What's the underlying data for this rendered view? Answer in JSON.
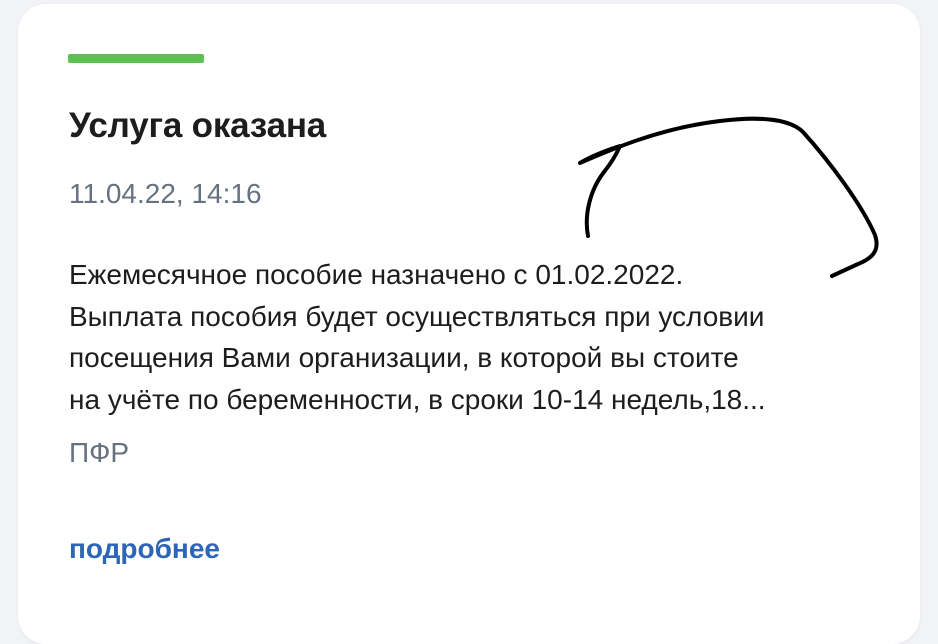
{
  "card": {
    "status_color": "#5cc150",
    "title": "Услуга оказана",
    "date": "11.04.22, 14:16",
    "description_lines": [
      "Ежемесячное пособие назначено с 01.02.2022.",
      "Выплата пособия будет осуществляться при условии",
      "посещения Вами организации, в которой вы стоите",
      "на учёте по беременности, в сроки 10-14 недель,18..."
    ],
    "source": "ПФР",
    "details_link": "подробнее",
    "accent_color": "#2d65b8"
  }
}
